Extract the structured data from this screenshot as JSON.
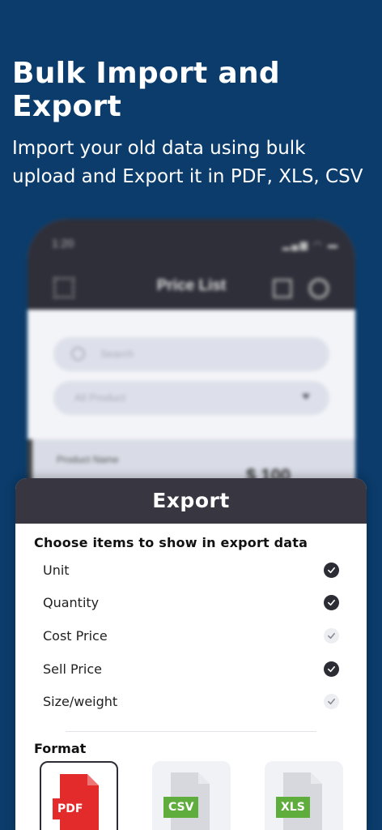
{
  "hero": {
    "title": "Bulk Import and Export",
    "subtitle_line1": "Import your old data using bulk",
    "subtitle_line2": "upload and Export it in PDF, XLS, CSV"
  },
  "background_phone": {
    "time": "1:20",
    "title": "Price List",
    "search_placeholder": "Search",
    "filter_value": "All Product",
    "row_name": "Product Name",
    "row_price": "$ 100"
  },
  "export_sheet": {
    "title": "Export",
    "heading": "Choose items to show in export data",
    "options": [
      {
        "label": "Unit",
        "checked": true
      },
      {
        "label": "Quantity",
        "checked": true
      },
      {
        "label": "Cost Price",
        "checked": false
      },
      {
        "label": "Sell Price",
        "checked": true
      },
      {
        "label": "Size/weight",
        "checked": false
      }
    ],
    "format_heading": "Format",
    "formats": [
      {
        "label": "PDF",
        "selected": true,
        "color": "#e32b2b"
      },
      {
        "label": "CSV",
        "selected": false,
        "color": "#5fae3d"
      },
      {
        "label": "XLS",
        "selected": false,
        "color": "#5fae3d"
      }
    ]
  },
  "colors": {
    "background": "#0b3c6b",
    "sheet_header": "#373641",
    "check_on": "#2c2c35"
  }
}
